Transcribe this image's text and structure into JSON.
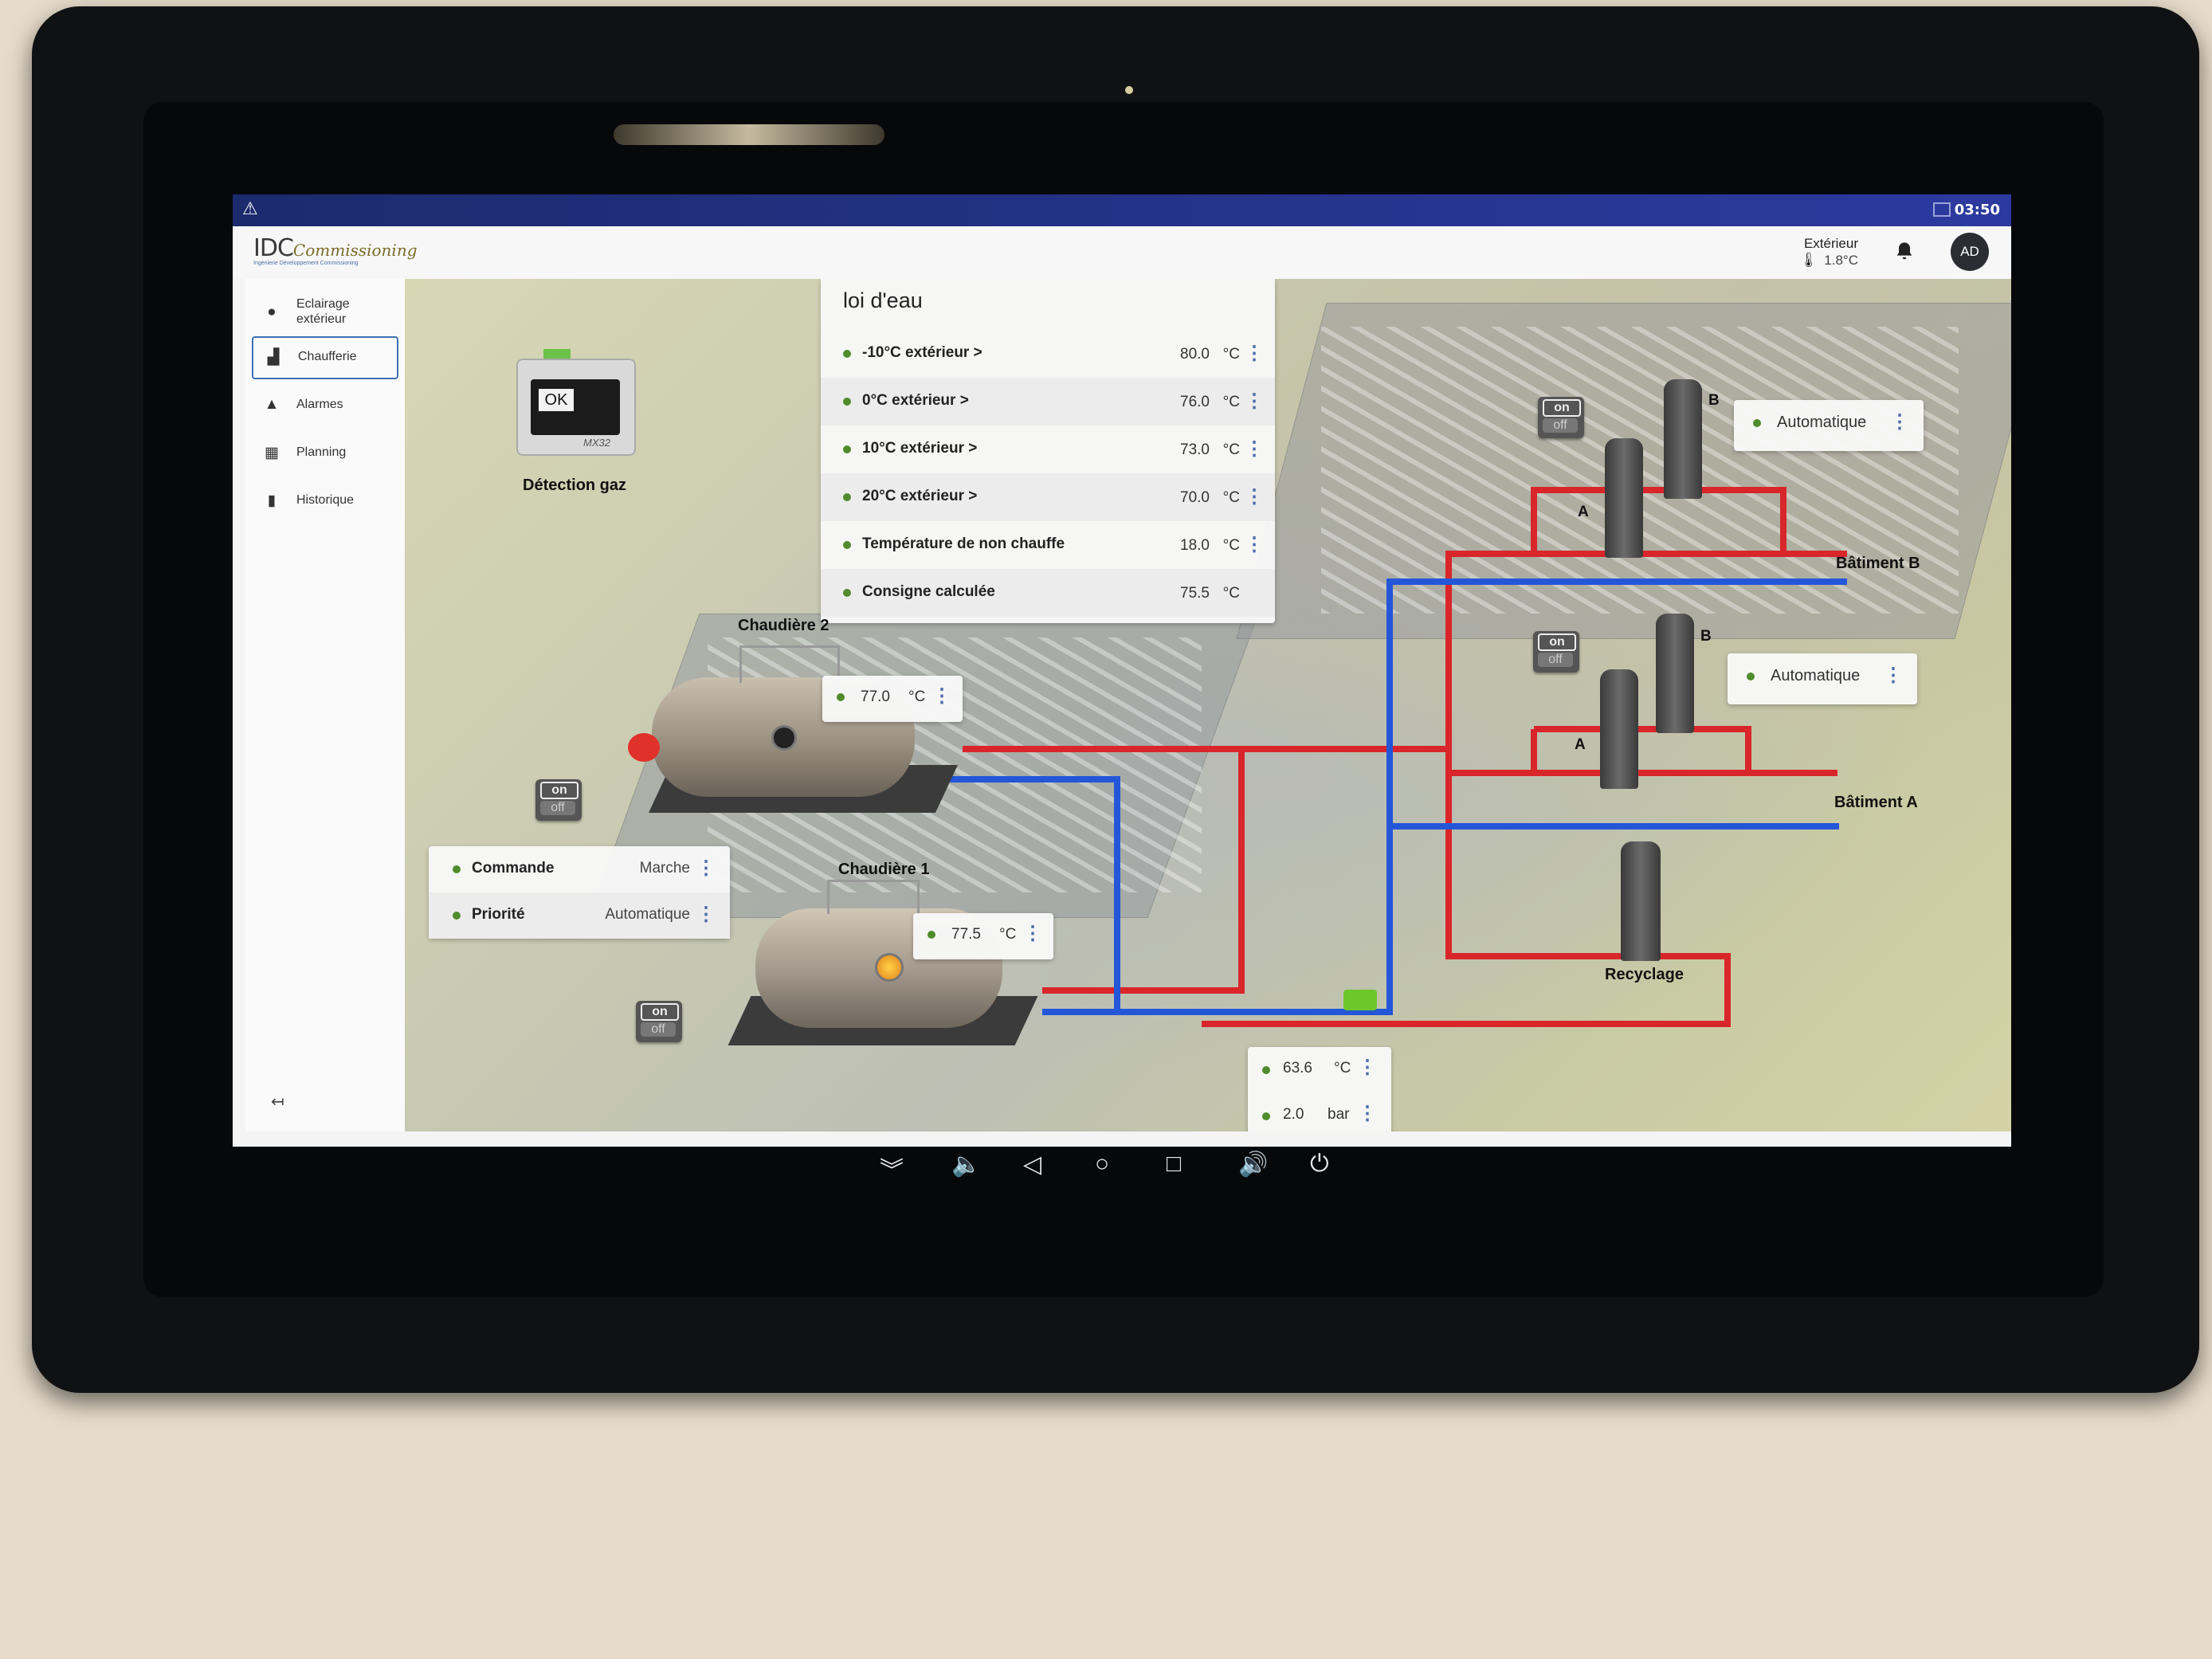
{
  "status_bar": {
    "warning_icon": "warning-triangle-icon",
    "time": "03:50"
  },
  "header": {
    "logo": {
      "brand_main": "IDC",
      "brand_script": "ommissioning",
      "tagline": "Ingénierie Développement Commissioning"
    },
    "exterior": {
      "label": "Extérieur",
      "value": "1.8°C",
      "icon": "thermometer-icon"
    },
    "notifications_icon": "bell-icon",
    "user_initials": "AD"
  },
  "sidebar": {
    "items": [
      {
        "label": "Eclairage extérieur",
        "icon": "lightbulb-icon",
        "active": false
      },
      {
        "label": "Chaufferie",
        "icon": "factory-icon",
        "active": true
      },
      {
        "label": "Alarmes",
        "icon": "bell-icon",
        "active": false
      },
      {
        "label": "Planning",
        "icon": "calendar-icon",
        "active": false
      },
      {
        "label": "Historique",
        "icon": "bar-chart-icon",
        "active": false
      }
    ],
    "collapse_icon": "arrow-left-icon"
  },
  "loi_deau": {
    "title": "loi d'eau",
    "rows": [
      {
        "label": "-10°C extérieur >",
        "value": "80.0",
        "unit": "°C"
      },
      {
        "label": "0°C extérieur >",
        "value": "76.0",
        "unit": "°C"
      },
      {
        "label": "10°C extérieur >",
        "value": "73.0",
        "unit": "°C"
      },
      {
        "label": "20°C extérieur >",
        "value": "70.0",
        "unit": "°C"
      },
      {
        "label": "Température de non chauffe",
        "value": "18.0",
        "unit": "°C"
      },
      {
        "label": "Consigne calculée",
        "value": "75.5",
        "unit": "°C"
      }
    ]
  },
  "gas_detection": {
    "label": "Détection gaz",
    "screen_text": "OK",
    "model": "MX32"
  },
  "boilers": {
    "chaudiere2": {
      "label": "Chaudière 2",
      "temp": "77.0",
      "unit": "°C"
    },
    "chaudiere1": {
      "label": "Chaudière 1",
      "temp": "77.5",
      "unit": "°C"
    }
  },
  "boiler_control": {
    "rows": [
      {
        "label": "Commande",
        "value": "Marche"
      },
      {
        "label": "Priorité",
        "value": "Automatique"
      }
    ]
  },
  "onoff": {
    "on": "on",
    "off": "off"
  },
  "buildings": {
    "batiment_b": {
      "label": "Bâtiment B",
      "mode": "Automatique",
      "pump_a": "A",
      "pump_b": "B"
    },
    "batiment_a": {
      "label": "Bâtiment A",
      "mode": "Automatique",
      "pump_a": "A",
      "pump_b": "B"
    }
  },
  "recyclage": {
    "label": "Recyclage"
  },
  "return_sensor": {
    "temp": "63.6",
    "temp_unit": "°C",
    "pressure": "2.0",
    "pressure_unit": "bar"
  },
  "android_nav": {
    "icons": [
      "collapse-icon",
      "volume-down-icon",
      "back-icon",
      "home-icon",
      "recents-icon",
      "volume-up-icon",
      "power-icon"
    ],
    "glyphs": [
      "︾",
      "🔈",
      "◁",
      "○",
      "□",
      "🔊",
      "⏻"
    ]
  },
  "colors": {
    "hot_pipe": "#d8262a",
    "cold_pipe": "#2456d8",
    "status_dot": "#4f8c2c",
    "accent": "#3f6fb4"
  }
}
